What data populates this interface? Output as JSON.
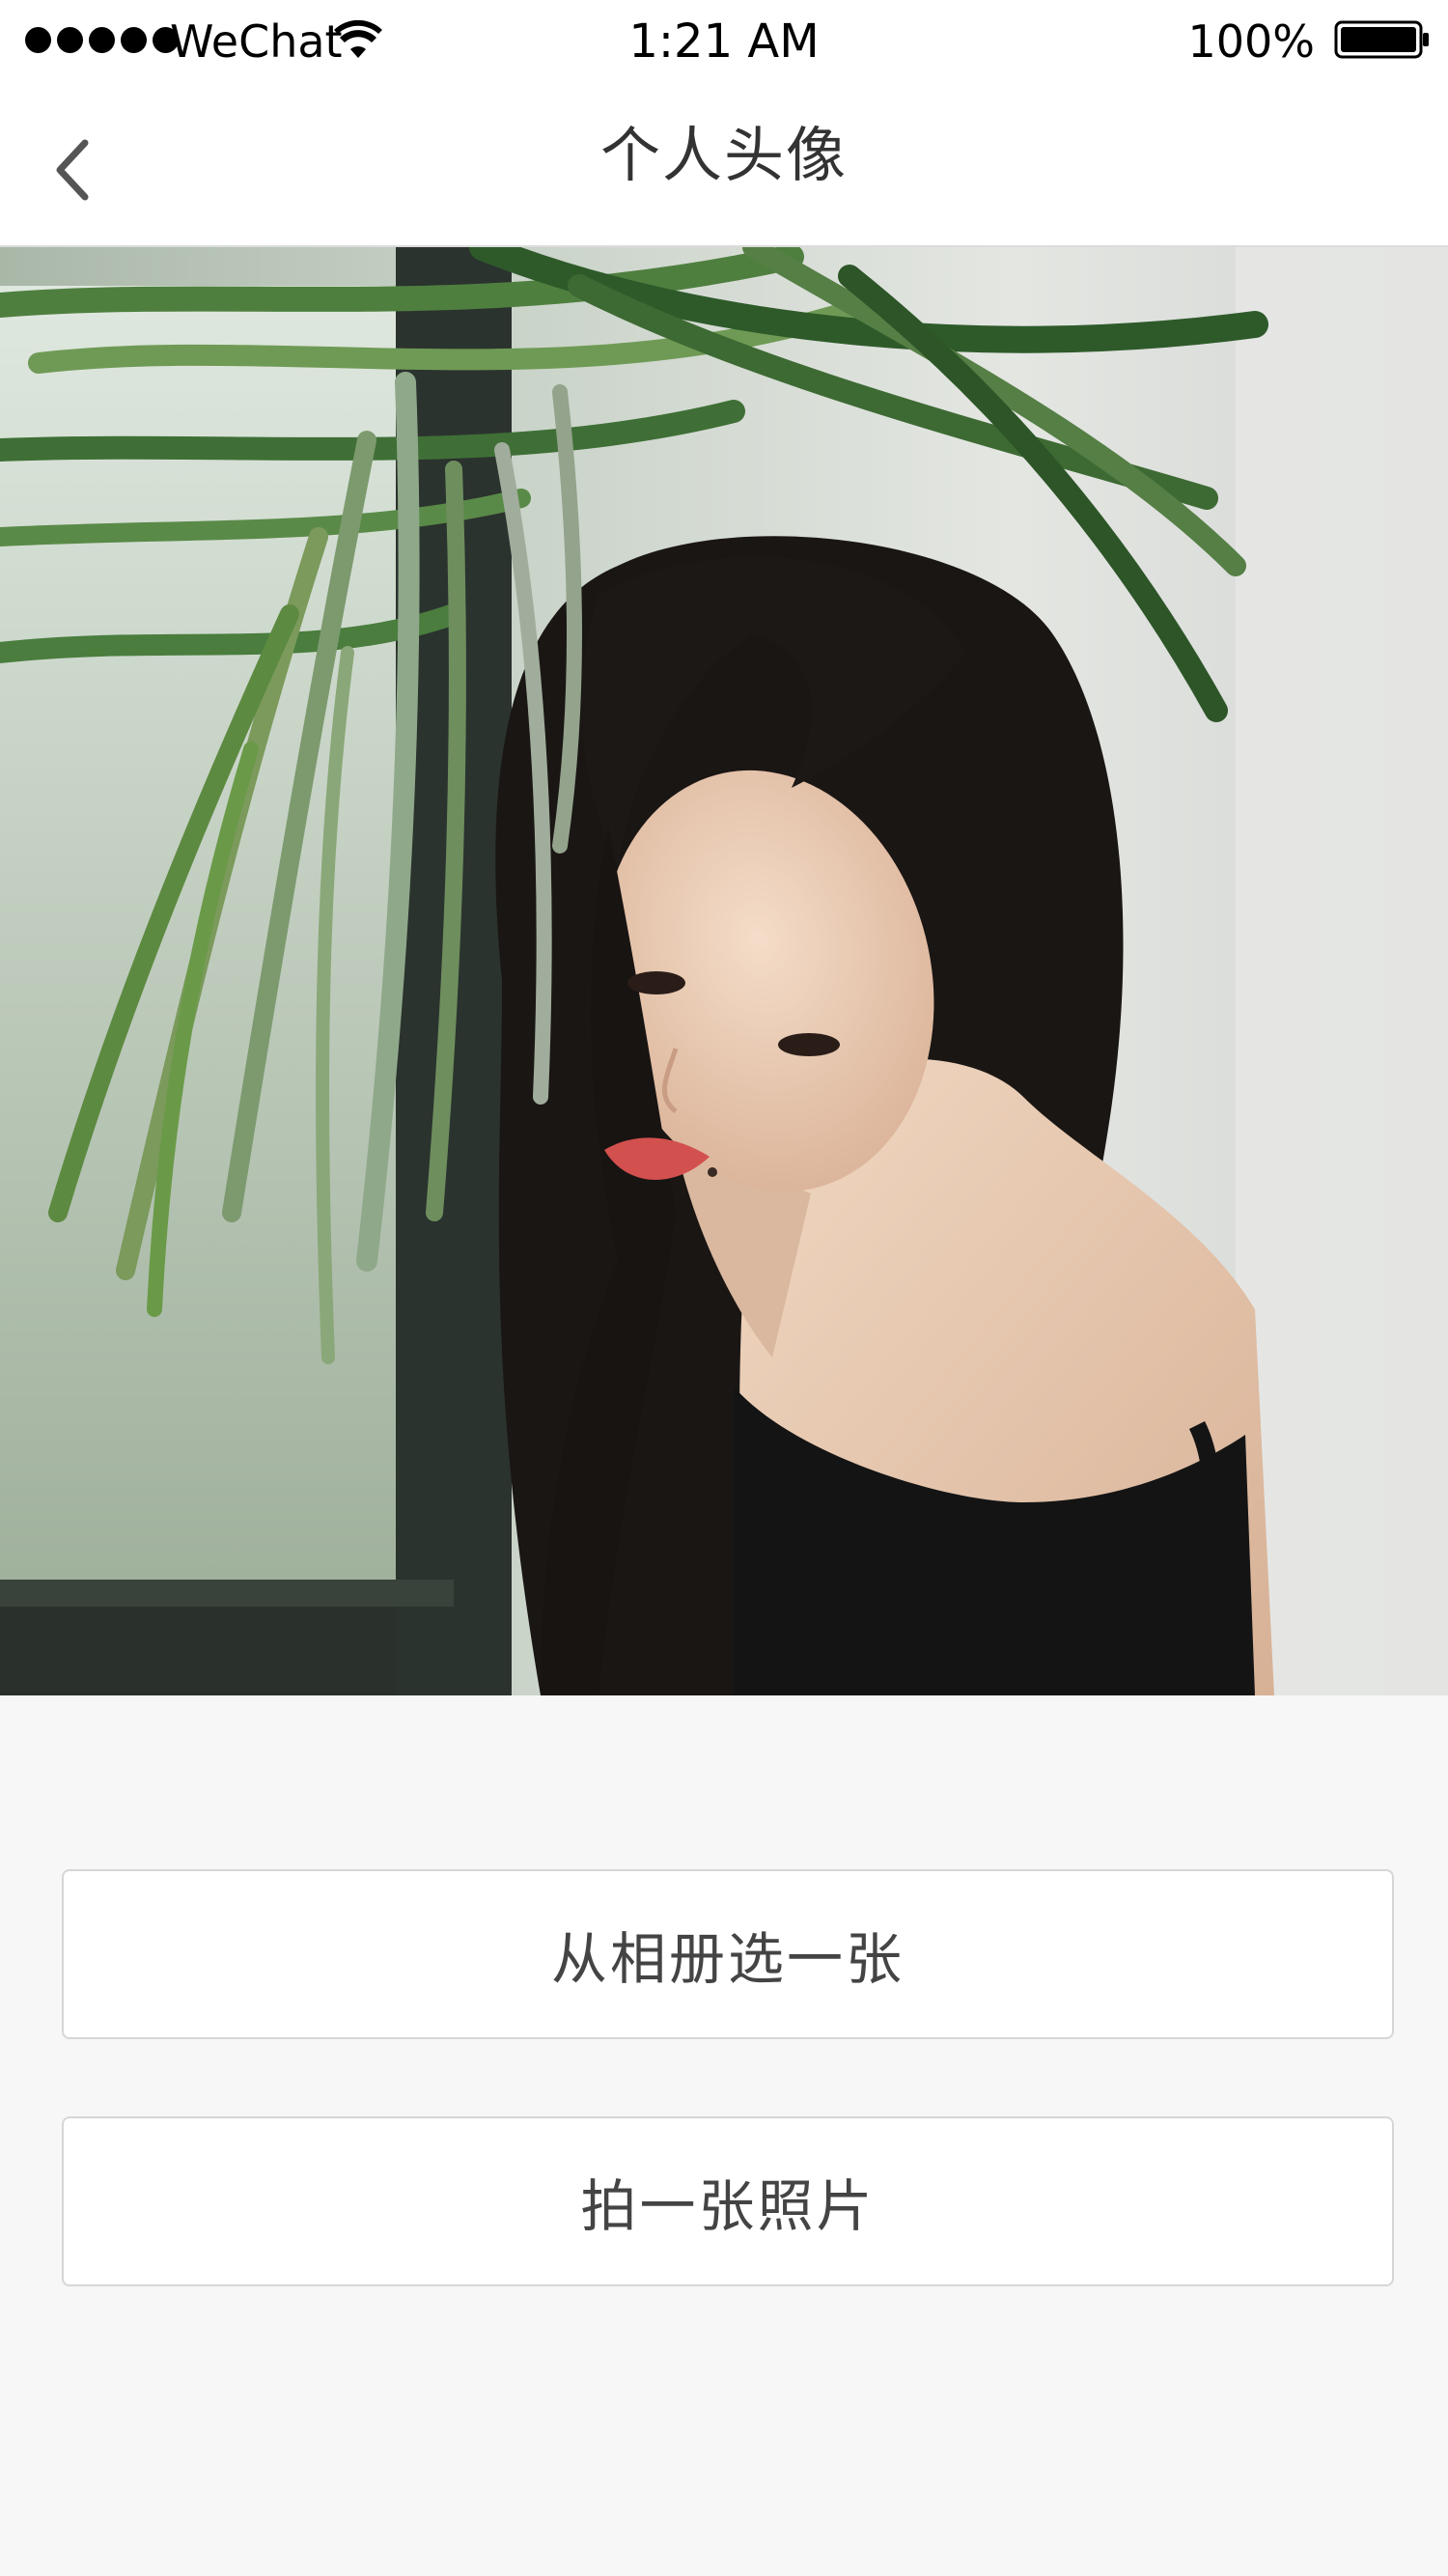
{
  "status_bar": {
    "carrier": "WeChat",
    "time": "1:21 AM",
    "battery": "100%",
    "signal_icon": "signal-dots-icon",
    "wifi_icon": "wifi-icon",
    "battery_icon": "battery-full-icon"
  },
  "nav": {
    "title": "个人头像",
    "back_icon": "chevron-left-icon"
  },
  "avatar": {
    "description_icon": "profile-photo"
  },
  "actions": {
    "choose_from_album": "从相册选一张",
    "take_photo": "拍一张照片"
  },
  "colors": {
    "background": "#f7f7f7",
    "nav_background": "#ffffff",
    "text_primary": "#333333",
    "button_border": "#d6d6d6"
  }
}
